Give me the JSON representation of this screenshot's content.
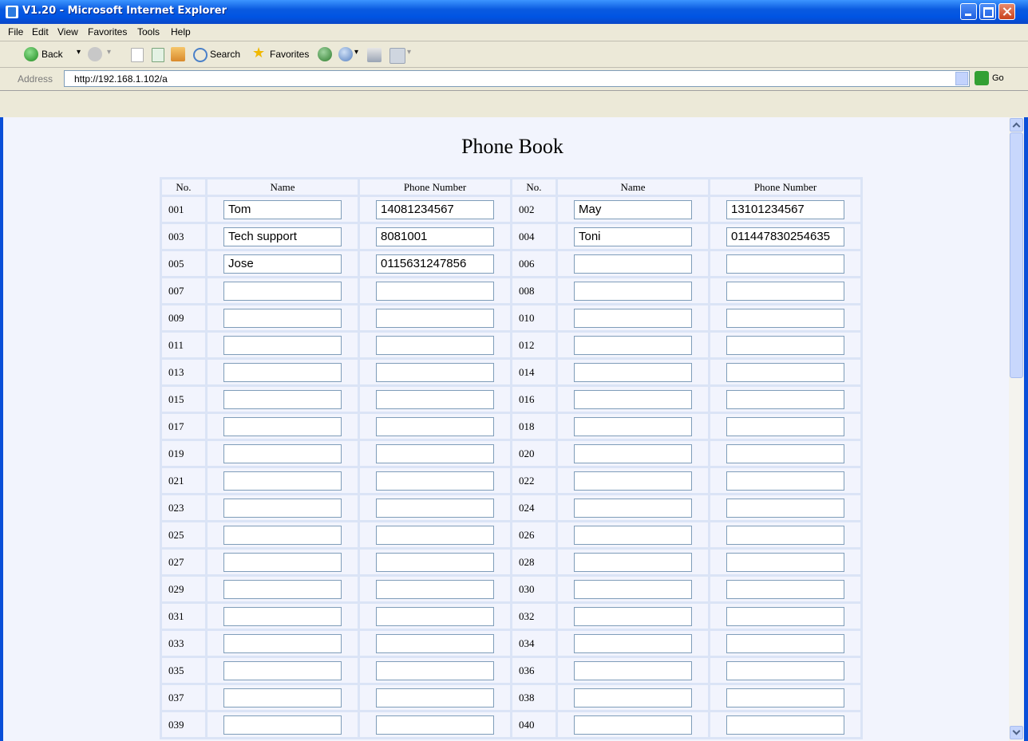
{
  "window": {
    "title": "V1.20 - Microsoft Internet Explorer"
  },
  "menu": [
    "File",
    "Edit",
    "View",
    "Favorites",
    "Tools",
    "Help"
  ],
  "toolbar": {
    "back": "Back",
    "search": "Search",
    "favorites": "Favorites"
  },
  "address": {
    "label": "Address",
    "url": "http://192.168.1.102/a",
    "go": "Go"
  },
  "page": {
    "title": "Phone Book"
  },
  "table": {
    "headers": [
      "No.",
      "Name",
      "Phone Number",
      "No.",
      "Name",
      "Phone Number"
    ],
    "rows": [
      [
        {
          "no": "001",
          "name": "Tom",
          "phone": "14081234567"
        },
        {
          "no": "002",
          "name": "May",
          "phone": "13101234567"
        }
      ],
      [
        {
          "no": "003",
          "name": "Tech support",
          "phone": "8081001"
        },
        {
          "no": "004",
          "name": "Toni",
          "phone": "011447830254635"
        }
      ],
      [
        {
          "no": "005",
          "name": "Jose",
          "phone": "0115631247856"
        },
        {
          "no": "006",
          "name": "",
          "phone": ""
        }
      ],
      [
        {
          "no": "007",
          "name": "",
          "phone": ""
        },
        {
          "no": "008",
          "name": "",
          "phone": ""
        }
      ],
      [
        {
          "no": "009",
          "name": "",
          "phone": ""
        },
        {
          "no": "010",
          "name": "",
          "phone": ""
        }
      ],
      [
        {
          "no": "011",
          "name": "",
          "phone": ""
        },
        {
          "no": "012",
          "name": "",
          "phone": ""
        }
      ],
      [
        {
          "no": "013",
          "name": "",
          "phone": ""
        },
        {
          "no": "014",
          "name": "",
          "phone": ""
        }
      ],
      [
        {
          "no": "015",
          "name": "",
          "phone": ""
        },
        {
          "no": "016",
          "name": "",
          "phone": ""
        }
      ],
      [
        {
          "no": "017",
          "name": "",
          "phone": ""
        },
        {
          "no": "018",
          "name": "",
          "phone": ""
        }
      ],
      [
        {
          "no": "019",
          "name": "",
          "phone": ""
        },
        {
          "no": "020",
          "name": "",
          "phone": ""
        }
      ],
      [
        {
          "no": "021",
          "name": "",
          "phone": ""
        },
        {
          "no": "022",
          "name": "",
          "phone": ""
        }
      ],
      [
        {
          "no": "023",
          "name": "",
          "phone": ""
        },
        {
          "no": "024",
          "name": "",
          "phone": ""
        }
      ],
      [
        {
          "no": "025",
          "name": "",
          "phone": ""
        },
        {
          "no": "026",
          "name": "",
          "phone": ""
        }
      ],
      [
        {
          "no": "027",
          "name": "",
          "phone": ""
        },
        {
          "no": "028",
          "name": "",
          "phone": ""
        }
      ],
      [
        {
          "no": "029",
          "name": "",
          "phone": ""
        },
        {
          "no": "030",
          "name": "",
          "phone": ""
        }
      ],
      [
        {
          "no": "031",
          "name": "",
          "phone": ""
        },
        {
          "no": "032",
          "name": "",
          "phone": ""
        }
      ],
      [
        {
          "no": "033",
          "name": "",
          "phone": ""
        },
        {
          "no": "034",
          "name": "",
          "phone": ""
        }
      ],
      [
        {
          "no": "035",
          "name": "",
          "phone": ""
        },
        {
          "no": "036",
          "name": "",
          "phone": ""
        }
      ],
      [
        {
          "no": "037",
          "name": "",
          "phone": ""
        },
        {
          "no": "038",
          "name": "",
          "phone": ""
        }
      ],
      [
        {
          "no": "039",
          "name": "",
          "phone": ""
        },
        {
          "no": "040",
          "name": "",
          "phone": ""
        }
      ]
    ]
  }
}
